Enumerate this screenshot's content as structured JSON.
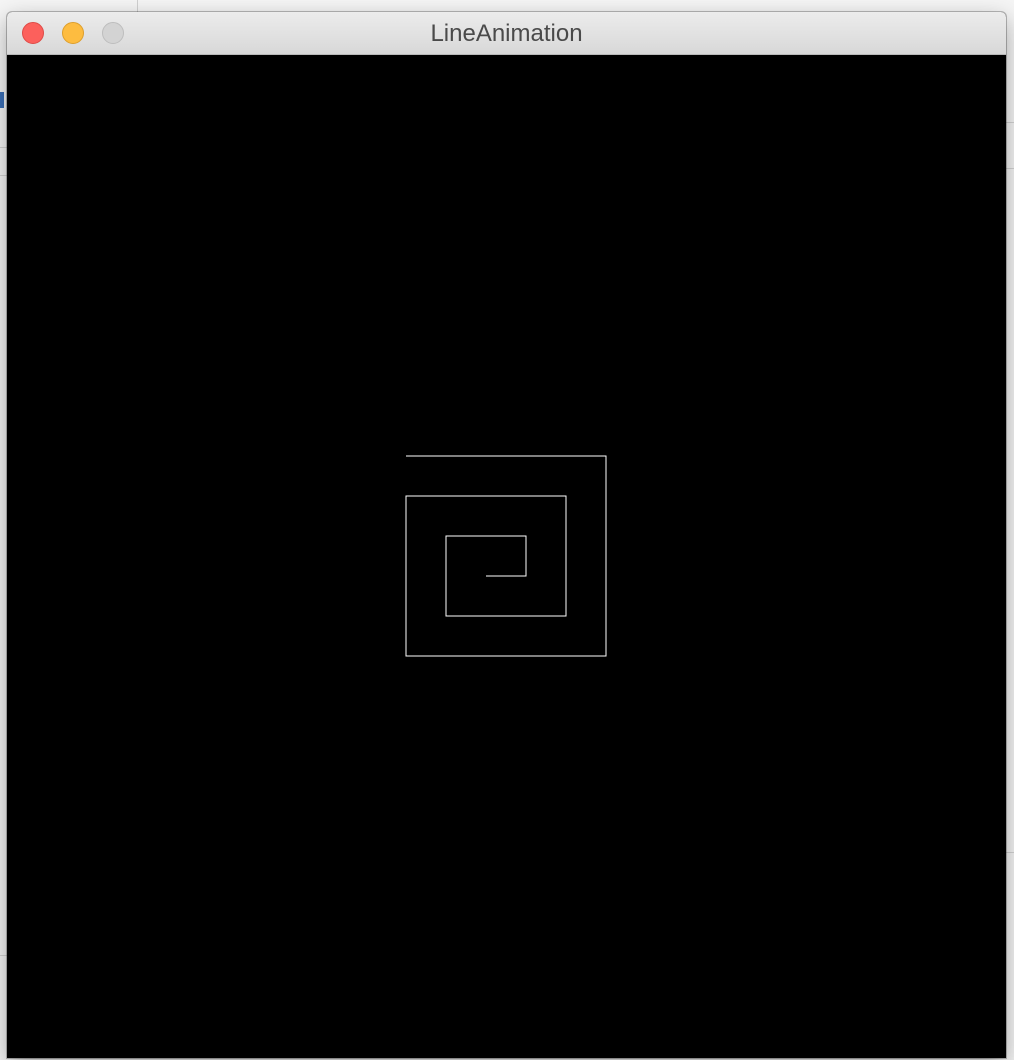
{
  "window": {
    "title": "LineAnimation",
    "controls": {
      "close": {
        "icon": "close-icon",
        "color": "#fc605c"
      },
      "minimize": {
        "icon": "minimize-icon",
        "color": "#fdbc40"
      },
      "zoom": {
        "icon": "zoom-icon",
        "color": "#d3d3d3"
      }
    }
  },
  "canvas": {
    "background": "#000000",
    "stroke_color": "#ffffff",
    "drawing": "square-spiral"
  }
}
